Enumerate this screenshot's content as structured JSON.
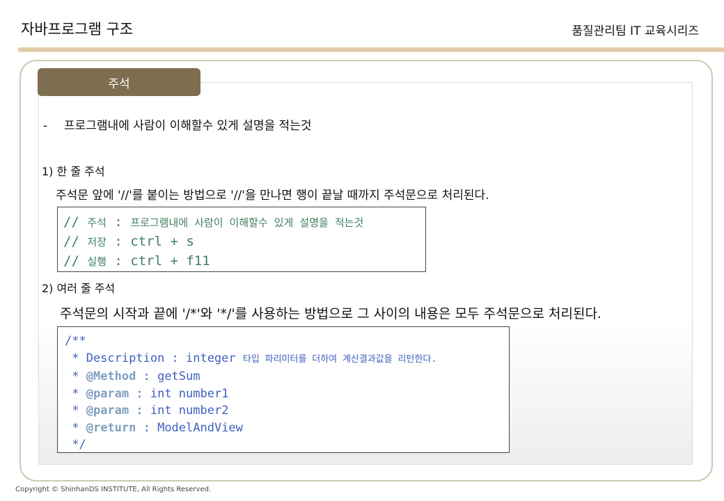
{
  "header": {
    "title": "자바프로그램 구조",
    "series": "품질관리팀 IT 교육시리즈"
  },
  "section_tab": "주석",
  "intro": {
    "dash": "-",
    "text": "프로그램내에 사람이 이해할수 있게 설명을 적는것"
  },
  "single_line": {
    "heading": "1) 한 줄 주석",
    "description": "주석문 앞에 '//'를 붙이는 방법으로 '//'을 만나면 행이 끝날 때까지 주석문으로 처리된다.",
    "code": [
      {
        "prefix": "// ",
        "label": "주석",
        "sep": " : ",
        "value": "프로그램내에 사람이 이해할수 있게 설명을 적는것"
      },
      {
        "prefix": "// ",
        "label": "저장",
        "sep": " : ",
        "value": "ctrl + s"
      },
      {
        "prefix": "// ",
        "label": "실행",
        "sep": " : ",
        "value": "ctrl + f11"
      }
    ]
  },
  "multi_line": {
    "heading": "2) 여러 줄 주석",
    "description": "주석문의 시작과 끝에 '/*'와 '*/'를 사용하는 방법으로 그 사이의 내용은 모두 주석문으로 처리된다.",
    "code": {
      "open": "/**",
      "desc_label": " * Description : integer ",
      "desc_ko": "타입 파리미터를 더하여 계산결과값을 리턴한다.",
      "method_tag": "@Method",
      "method_val": " : getSum",
      "param1_tag": "@param",
      "param1_val": " : int number1",
      "param2_tag": "@param",
      "param2_val": " : int number2",
      "return_tag": "@return",
      "return_val": " : ModelAndView",
      "star_prefix": " * ",
      "close": " */"
    }
  },
  "footer": {
    "copyright": "Copyright © ShinhanDS INSTITUTE, All Rights Reserved."
  },
  "colors": {
    "tab_bg": "#7d6e50",
    "rule": "#dcc49c",
    "frame_border": "#cfc9b2",
    "code_green": "#3f7f5f",
    "code_blue": "#3f5fbf",
    "code_tag": "#7f9fbf"
  }
}
